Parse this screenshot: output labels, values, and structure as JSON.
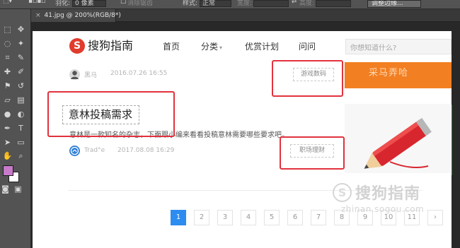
{
  "photoshop": {
    "options": {
      "feather_label": "羽化:",
      "feather_value": "0 像素",
      "antialias_label": "消除锯齿",
      "style_label": "样式:",
      "style_value": "正常",
      "width_label": "宽度:",
      "height_label": "高度:",
      "refine_edge_button": "调整边缘..."
    },
    "document_tab": {
      "close_glyph": "×",
      "title": "41.jpg @ 200%(RGB/8*)"
    },
    "colors": {
      "foreground": "#c67ac8",
      "background": "#ffffff"
    }
  },
  "site": {
    "logo": {
      "icon": "sogou-logo-icon",
      "mark": "S",
      "text": "搜狗指南"
    },
    "nav": {
      "home": "首页",
      "category": "分类",
      "category_caret": "▾",
      "featured": "优赏计划",
      "qa": "问问"
    },
    "search": {
      "placeholder": "你想知道什么?"
    },
    "articles": [
      {
        "author": "黑马",
        "date": "2016.07.26 16:55",
        "tag": "游戏数码"
      },
      {
        "title": "意林投稿需求",
        "summary": "意林是一款知名的杂志，下面跟小编来看看投稿意林需要哪些要求吧。",
        "author": "Trad°e",
        "date": "2017.08.08 16:29",
        "tag": "职场理财"
      }
    ],
    "thumbnail_text": "采马弄哈",
    "pagination": [
      "1",
      "2",
      "3",
      "4",
      "5",
      "6",
      "7",
      "8",
      "9",
      "10",
      "11",
      "›"
    ],
    "accent_color": "#2d8cf0"
  },
  "watermark": {
    "mark": "S",
    "text": "搜狗指南",
    "url": "zhinan.sogou.com"
  },
  "annotation_color": "#e2323d"
}
